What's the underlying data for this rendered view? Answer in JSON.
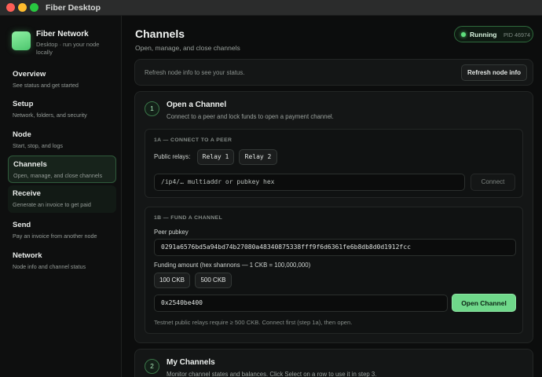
{
  "window": {
    "title": "Fiber Desktop"
  },
  "brand": {
    "name": "Fiber Network",
    "subtitle": "Desktop · run your node locally"
  },
  "sidebar": {
    "items": [
      {
        "label": "Overview",
        "sub": "See status and get started"
      },
      {
        "label": "Setup",
        "sub": "Network, folders, and security"
      },
      {
        "label": "Node",
        "sub": "Start, stop, and logs"
      },
      {
        "label": "Channels",
        "sub": "Open, manage, and close channels"
      },
      {
        "label": "Receive",
        "sub": "Generate an invoice to get paid"
      },
      {
        "label": "Send",
        "sub": "Pay an invoice from another node"
      },
      {
        "label": "Network",
        "sub": "Node info and channel status"
      }
    ],
    "active": "Channels"
  },
  "header": {
    "title": "Channels",
    "subtitle": "Open, manage, and close channels",
    "status": {
      "label": "Running",
      "pid": "PID 46974",
      "color": "#5ee07d"
    }
  },
  "refresh": {
    "text": "Refresh node info to see your status.",
    "button": "Refresh node info"
  },
  "step1": {
    "number": "1",
    "title": "Open a Channel",
    "description": "Connect to a peer and lock funds to open a payment channel.",
    "connect": {
      "heading": "1A — CONNECT TO A PEER",
      "relays_label": "Public relays:",
      "relays": [
        "Relay 1",
        "Relay 2"
      ],
      "input_placeholder": "/ip4/… multiaddr or pubkey hex",
      "button": "Connect"
    },
    "fund": {
      "heading": "1B — FUND A CHANNEL",
      "pubkey_label": "Peer pubkey",
      "pubkey_value": "0291a6576bd5a94bd74b27080a48340875338fff9f6d6361fe6b8db8d0d1912fcc",
      "amount_label": "Funding amount (hex shannons — 1 CKB = 100,000,000)",
      "presets": [
        "100 CKB",
        "500 CKB"
      ],
      "amount_value": "0x2540be400",
      "button": "Open Channel",
      "hint": "Testnet public relays require ≥ 500 CKB. Connect first (step 1a), then open."
    }
  },
  "step2": {
    "number": "2",
    "title": "My Channels",
    "description": "Monitor channel states and balances. Click Select on a row to use it in step 3."
  },
  "colors": {
    "accent": "#6fd88a",
    "background": "#0c0d0d"
  }
}
